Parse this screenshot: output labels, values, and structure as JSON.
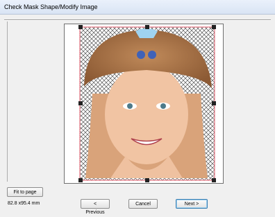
{
  "window": {
    "title": "Check Mask Shape/Modify Image"
  },
  "buttons": {
    "fit_to_page": "Fit to page",
    "previous": "< Previous",
    "cancel": "Cancel",
    "next": "Next >"
  },
  "status": {
    "dimensions": "82.8 x95.4 mm"
  },
  "colors": {
    "mask_outline": "#e25a6a",
    "handle": "#222222",
    "titlebar": "#dce6f5"
  }
}
